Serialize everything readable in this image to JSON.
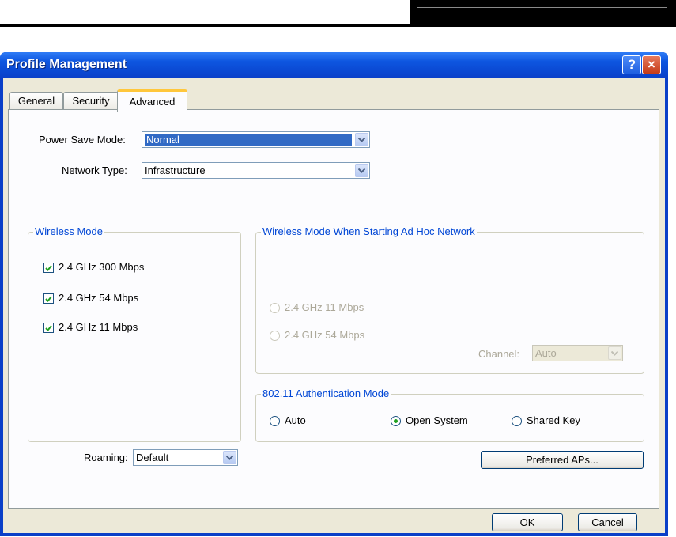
{
  "dialog": {
    "title": "Profile Management",
    "help_glyph": "?",
    "close_glyph": "×"
  },
  "tabs": [
    {
      "label": "General"
    },
    {
      "label": "Security"
    },
    {
      "label": "Advanced",
      "active": true
    }
  ],
  "advanced": {
    "power_save_label": "Power Save Mode:",
    "power_save_value": "Normal",
    "network_type_label": "Network Type:",
    "network_type_value": "Infrastructure",
    "wireless_mode": {
      "legend": "Wireless Mode",
      "options": [
        {
          "label": "2.4 GHz 300 Mbps",
          "checked": true
        },
        {
          "label": "2.4 GHz 54 Mbps",
          "checked": true
        },
        {
          "label": "2.4 GHz 11 Mbps",
          "checked": true
        }
      ]
    },
    "adhoc": {
      "legend": "Wireless Mode When Starting Ad Hoc Network",
      "options": [
        {
          "label": "2.4 GHz 11 Mbps",
          "selected": false
        },
        {
          "label": "2.4 GHz 54 Mbps",
          "selected": false
        }
      ],
      "channel_label": "Channel:",
      "channel_value": "Auto"
    },
    "auth": {
      "legend": "802.11 Authentication Mode",
      "options": [
        {
          "label": "Auto",
          "selected": false
        },
        {
          "label": "Open System",
          "selected": true
        },
        {
          "label": "Shared Key",
          "selected": false
        }
      ]
    },
    "roaming_label": "Roaming:",
    "roaming_value": "Default",
    "preferred_aps_label": "Preferred APs..."
  },
  "footer": {
    "ok_label": "OK",
    "cancel_label": "Cancel"
  },
  "colors": {
    "title_bar": "#0a48d2",
    "dialog_bg": "#ece9d8",
    "group_legend": "#0046d5",
    "selection": "#316ac5",
    "radio_dot": "#21a121"
  }
}
